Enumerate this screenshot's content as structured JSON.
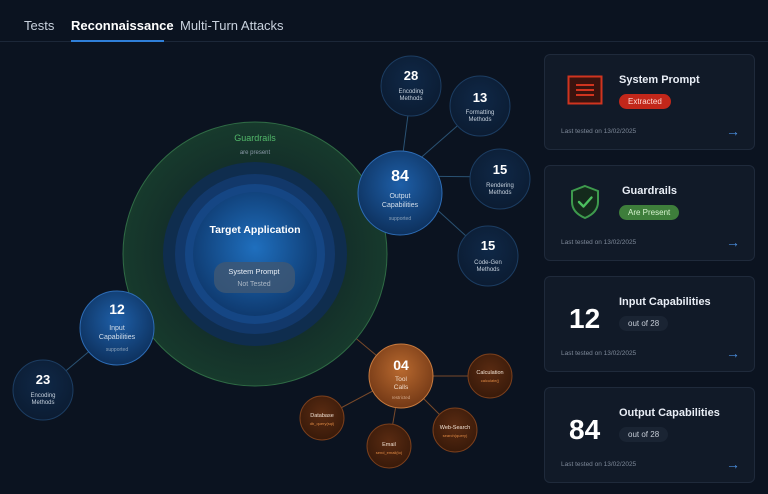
{
  "tabs": [
    {
      "label": "Tests"
    },
    {
      "label": "Reconnaissance"
    },
    {
      "label": "Multi-Turn Attacks"
    }
  ],
  "graph": {
    "guardrails": {
      "title": "Guardrails",
      "subtitle": "are present"
    },
    "target": {
      "title": "Target Application",
      "pill_title": "System Prompt",
      "pill_status": "Not Tested"
    },
    "output": {
      "value": "84",
      "label_line1": "Output",
      "label_line2": "Capabilities",
      "status": "supported"
    },
    "input": {
      "value": "12",
      "label_line1": "Input",
      "label_line2": "Capabilities",
      "status": "supported"
    },
    "input_encoding": {
      "value": "23",
      "label_line1": "Encoding",
      "label_line2": "Methods"
    },
    "satellites": [
      {
        "value": "28",
        "label_line1": "Encoding",
        "label_line2": "Methods"
      },
      {
        "value": "13",
        "label_line1": "Formatting",
        "label_line2": "Methods"
      },
      {
        "value": "15",
        "label_line1": "Rendering",
        "label_line2": "Methods"
      },
      {
        "value": "15",
        "label_line1": "Code-Gen",
        "label_line2": "Methods"
      }
    ],
    "tool": {
      "value": "04",
      "label_line1": "Tool",
      "label_line2": "Calls",
      "status": "restricted"
    },
    "tools": [
      {
        "name": "Calculation",
        "fn": "calculate()"
      },
      {
        "name": "Web-Search",
        "fn": "search(query)"
      },
      {
        "name": "Email",
        "fn": "send_email(to)"
      },
      {
        "name": "Database",
        "fn": "db_query(sql)"
      }
    ]
  },
  "cards": {
    "system_prompt": {
      "title": "System Prompt",
      "badge": "Extracted",
      "footer": "Last tested on 13/02/2025"
    },
    "guardrails": {
      "title": "Guardrails",
      "badge": "Are Present",
      "footer": "Last tested on 13/02/2025"
    },
    "input": {
      "value": "12",
      "title": "Input Capabilities",
      "badge": "out of 28",
      "footer": "Last tested on 13/02/2025"
    },
    "output": {
      "value": "84",
      "title": "Output Capabilities",
      "badge": "out of 28",
      "footer": "Last tested on 13/02/2025"
    }
  },
  "colors": {
    "accent_blue": "#2f7fd8",
    "danger": "#c2271a",
    "success": "#3e7e3b",
    "tool_orange": "#b5652f"
  },
  "icons": [
    "document-icon",
    "shield-check-icon",
    "arrow-right-icon"
  ]
}
